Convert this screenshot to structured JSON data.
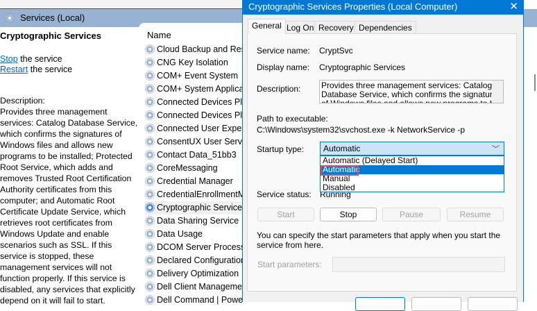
{
  "header": {
    "title": "Services (Local)"
  },
  "left_pane": {
    "service_title": "Cryptographic Services",
    "stop_link": "Stop",
    "stop_suffix": " the service",
    "restart_link": "Restart",
    "restart_suffix": " the service",
    "description_label": "Description:",
    "description": "Provides three management services: Catalog Database Service, which confirms the signatures of Windows files and allows new programs to be installed; Protected Root Service, which adds and removes Trusted Root Certification Authority certificates from this computer; and Automatic Root Certificate Update Service, which retrieves root certificates from Windows Update and enable scenarios such as SSL. If this service is stopped, these management services will not function properly. If this service is disabled, any services that explicitly depend on it will fail to start."
  },
  "list": {
    "column_name": "Name",
    "rows": [
      "Cloud Backup and Restore",
      "CNG Key Isolation",
      "COM+ Event System",
      "COM+ System Application",
      "Connected Devices Platform",
      "Connected Devices Platform",
      "Connected User Experiences",
      "ConsentUX User Service",
      "Contact Data_51bb3",
      "CoreMessaging",
      "Credential Manager",
      "CredentialEnrollmentManager",
      "Cryptographic Services",
      "Data Sharing Service",
      "Data Usage",
      "DCOM Server Process Launcher",
      "Declared Configuration",
      "Delivery Optimization",
      "Dell Client Management",
      "Dell Command | Power"
    ],
    "selected_index": 12
  },
  "dialog": {
    "title": "Cryptographic Services Properties (Local Computer)",
    "close": "✕",
    "tabs": [
      "General",
      "Log On",
      "Recovery",
      "Dependencies"
    ],
    "service_name_label": "Service name:",
    "service_name": "CryptSvc",
    "display_name_label": "Display name:",
    "display_name": "Cryptographic Services",
    "description_label": "Description:",
    "description": "Provides three management services: Catalog Database Service, which confirms the signatures of Windows files and allows new programs to be",
    "path_label": "Path to executable:",
    "path": "C:\\Windows\\system32\\svchost.exe -k NetworkService -p",
    "startup_label": "Startup type:",
    "startup_value": "Automatic",
    "startup_options": [
      "Automatic (Delayed Start)",
      "Automatic",
      "Manual",
      "Disabled"
    ],
    "status_label": "Service status:",
    "status": "Running",
    "buttons": {
      "start": "Start",
      "stop": "Stop",
      "pause": "Pause",
      "resume": "Resume"
    },
    "hint": "You can specify the start parameters that apply when you start the service from here.",
    "params_label": "Start parameters:"
  }
}
